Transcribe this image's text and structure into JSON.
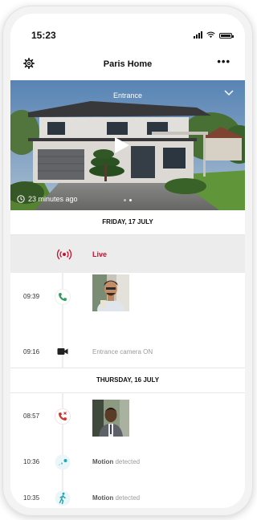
{
  "status_bar": {
    "time": "15:23"
  },
  "header": {
    "title": "Paris Home",
    "more_label": "•••"
  },
  "camera": {
    "name": "Entrance",
    "last_seen": "23 minutes ago",
    "page_count": 2,
    "active_page": 1
  },
  "timeline": {
    "days": [
      {
        "label": "FRIDAY, 17 JULY"
      },
      {
        "label": "THURSDAY, 16 JULY"
      }
    ],
    "events": [
      {
        "time": "",
        "label": "Live",
        "kind": "live"
      },
      {
        "time": "09:39",
        "label": "",
        "kind": "call-answered"
      },
      {
        "time": "09:16",
        "label": "Entrance camera ON",
        "kind": "camera-on"
      },
      {
        "time": "08:57",
        "label": "",
        "kind": "call-missed"
      },
      {
        "time": "10:36",
        "label_bold": "Motion",
        "label_rest": " detected",
        "kind": "motion"
      },
      {
        "time": "10:35",
        "label_bold": "Motion",
        "label_rest": " detected",
        "kind": "person"
      }
    ]
  },
  "colors": {
    "live": "#c8102e",
    "call_ok": "#2e9e5b",
    "call_missed": "#d0332f",
    "motion": "#27a6b9"
  }
}
